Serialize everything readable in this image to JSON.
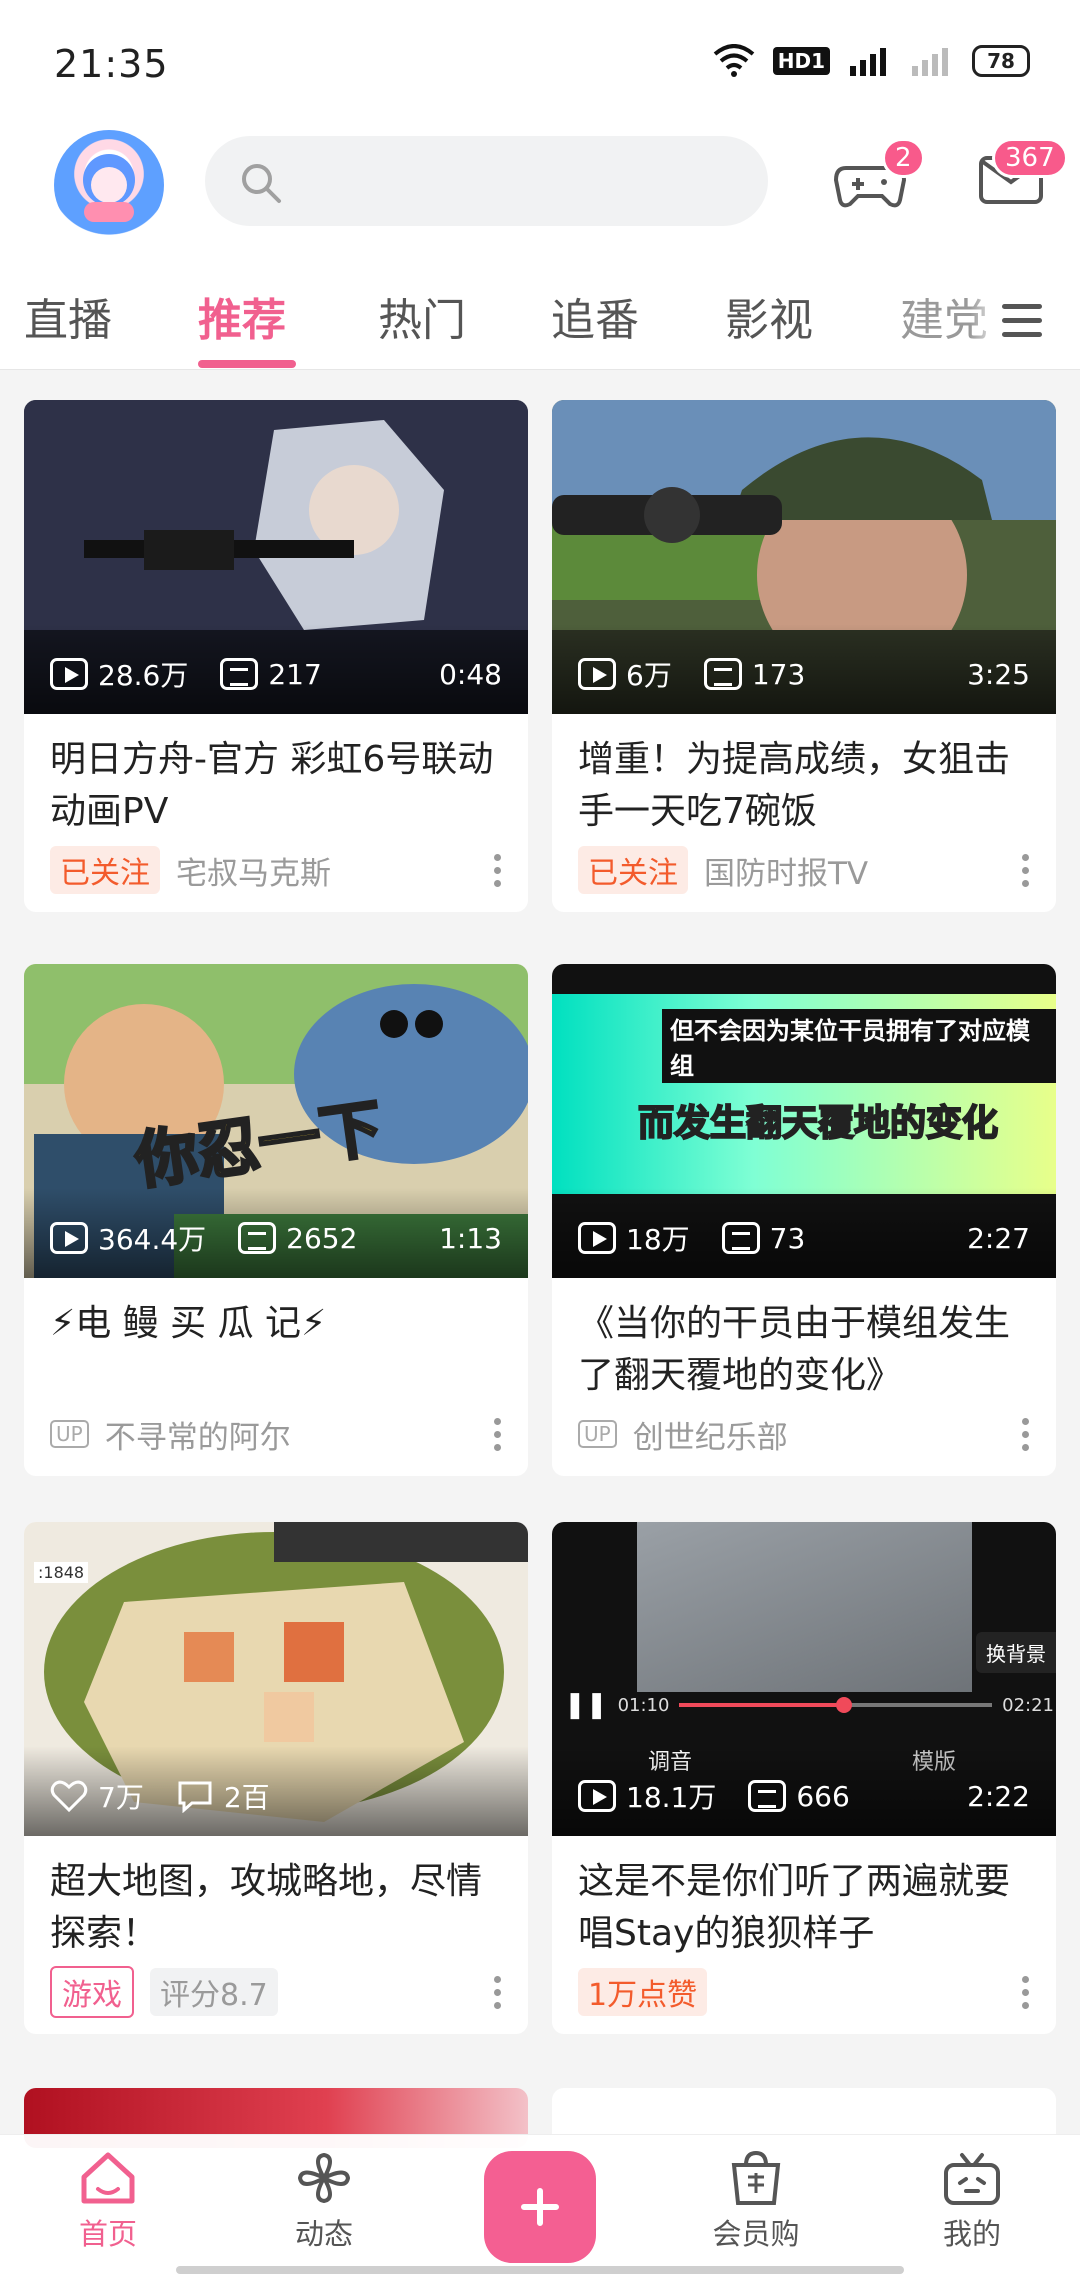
{
  "status": {
    "time": "21:35",
    "hd": "HD1",
    "network": "4G",
    "battery": "78"
  },
  "header": {
    "search_placeholder": "",
    "game_badge": "2",
    "message_badge": "367"
  },
  "tabs": [
    "直播",
    "推荐",
    "热门",
    "追番",
    "影视",
    "建党"
  ],
  "active_tab": "推荐",
  "cards": [
    {
      "views": "28.6万",
      "danmaku": "217",
      "duration": "0:48",
      "title": "明日方舟-官方 彩虹6号联动动画PV",
      "tag": "已关注",
      "author": "宅叔马克斯"
    },
    {
      "views": "6万",
      "danmaku": "173",
      "duration": "3:25",
      "title": "增重！为提高成绩，女狙击手一天吃7碗饭",
      "tag": "已关注",
      "author": "国防时报TV"
    },
    {
      "views": "364.4万",
      "danmaku": "2652",
      "duration": "1:13",
      "title": "⚡电 鳗 买 瓜 记⚡",
      "up": "UP",
      "author": "不寻常的阿尔",
      "overlay": "你忍一下"
    },
    {
      "views": "18万",
      "danmaku": "73",
      "duration": "2:27",
      "title": "《当你的干员由于模组发生了翻天覆地的变化》",
      "up": "UP",
      "author": "创世纪乐部",
      "overlay_top": "但不会因为某位干员拥有了对应模组",
      "overlay_main": "而发生翻天覆地的变化"
    },
    {
      "likes": "7万",
      "comments": "2百",
      "title": "超大地图，攻城略地，尽情探索！",
      "tag": "游戏",
      "score": "评分8.7",
      "map_label": ":1848"
    },
    {
      "views": "18.1万",
      "danmaku": "666",
      "duration": "2:22",
      "title": "这是不是你们听了两遍就要唱Stay的狼狈样子",
      "tag": "1万点赞",
      "player_time": "01:10",
      "player_total": "02:21",
      "player_btn": "换背景",
      "audio_label": "调音",
      "mode_label": "模版"
    }
  ],
  "bottom_nav": {
    "home": "首页",
    "dynamic": "动态",
    "shop": "会员购",
    "mine": "我的"
  },
  "colors": {
    "accent": "#f1608f",
    "follow": "#f35b2c"
  }
}
